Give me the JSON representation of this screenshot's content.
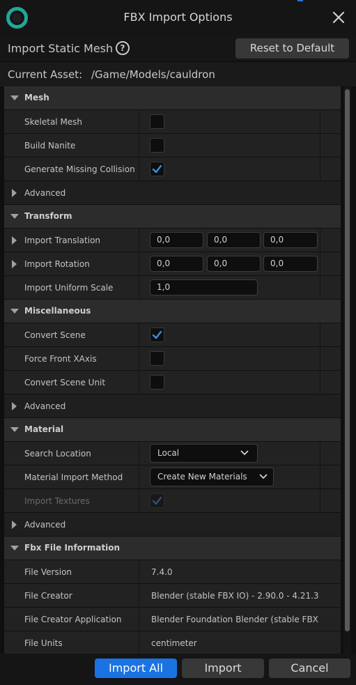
{
  "window": {
    "title": "FBX Import Options"
  },
  "toolbar": {
    "import_type": "Import Static Mesh",
    "help_glyph": "?",
    "reset_label": "Reset to Default"
  },
  "asset": {
    "label": "Current Asset:",
    "path": "/Game/Models/cauldron"
  },
  "sections": {
    "mesh": {
      "title": "Mesh",
      "skeletal_mesh": "Skeletal Mesh",
      "build_nanite": "Build Nanite",
      "gen_collision": "Generate Missing Collision",
      "advanced": "Advanced",
      "values": {
        "skeletal_mesh": false,
        "build_nanite": false,
        "gen_collision": true
      }
    },
    "transform": {
      "title": "Transform",
      "translation": "Import Translation",
      "rotation": "Import Rotation",
      "scale": "Import Uniform Scale",
      "translation_values": [
        "0,0",
        "0,0",
        "0,0"
      ],
      "rotation_values": [
        "0,0",
        "0,0",
        "0,0"
      ],
      "scale_value": "1,0"
    },
    "misc": {
      "title": "Miscellaneous",
      "convert_scene": "Convert Scene",
      "force_front": "Force Front XAxis",
      "convert_unit": "Convert Scene Unit",
      "advanced": "Advanced",
      "values": {
        "convert_scene": true,
        "force_front": false,
        "convert_unit": false
      }
    },
    "material": {
      "title": "Material",
      "search_location": "Search Location",
      "search_location_value": "Local",
      "import_method": "Material Import Method",
      "import_method_value": "Create New Materials",
      "import_textures": "Import Textures",
      "import_textures_value": true,
      "advanced": "Advanced"
    },
    "fbx_info": {
      "title": "Fbx File Information",
      "file_version": "File Version",
      "file_version_value": "7.4.0",
      "file_creator": "File Creator",
      "file_creator_value": "Blender (stable FBX IO) - 2.90.0 - 4.21.3",
      "creator_app": "File Creator Application",
      "creator_app_value": "Blender Foundation Blender (stable FBX IO",
      "file_units": "File Units",
      "file_units_value": "centimeter"
    }
  },
  "footer": {
    "import_all": "Import All",
    "import": "Import",
    "cancel": "Cancel"
  },
  "colors": {
    "accent": "#1a73e0",
    "logo": "#1fa99a",
    "check": "#3b8eea"
  }
}
